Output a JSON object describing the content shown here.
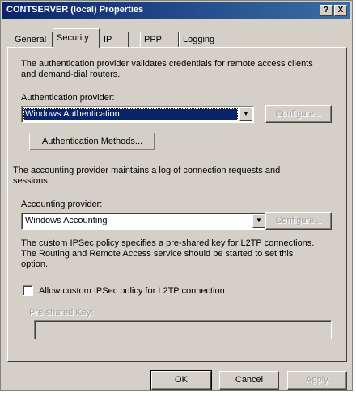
{
  "window": {
    "title": "CONTSERVER (local) Properties",
    "help_button": "?",
    "close_button": "X"
  },
  "tabs": [
    {
      "label": "General",
      "active": false
    },
    {
      "label": "Security",
      "active": true
    },
    {
      "label": "IP",
      "active": false
    },
    {
      "label": "PPP",
      "active": false
    },
    {
      "label": "Logging",
      "active": false
    }
  ],
  "authentication": {
    "description": [
      "The authentication provider validates credentials for remote access clients",
      "and demand-dial routers."
    ],
    "provider_label": "Authentication provider:",
    "provider_value": "Windows Authentication",
    "configure_label": "Configure...",
    "methods_button": "Authentication Methods..."
  },
  "accounting": {
    "description": [
      "The accounting provider maintains a log of connection requests and",
      "sessions."
    ],
    "provider_label": "Accounting provider:",
    "provider_value": "Windows Accounting",
    "configure_label": "Configure..."
  },
  "ipsec": {
    "description": [
      "The custom IPSec policy specifies a pre-shared key for L2TP connections.",
      "The Routing and Remote Access service should be started to set this",
      "option."
    ],
    "checkbox_label": "Allow custom IPSec policy for L2TP connection",
    "checked": false,
    "preshared_key_label": "Pre-shared Key:",
    "preshared_key_value": ""
  },
  "footer": {
    "ok": "OK",
    "cancel": "Cancel",
    "apply": "Apply"
  },
  "colors": {
    "title_start": "#0a246a",
    "title_end": "#3a6ea5",
    "face": "#d4d0c8",
    "selection": "#0a246a"
  }
}
